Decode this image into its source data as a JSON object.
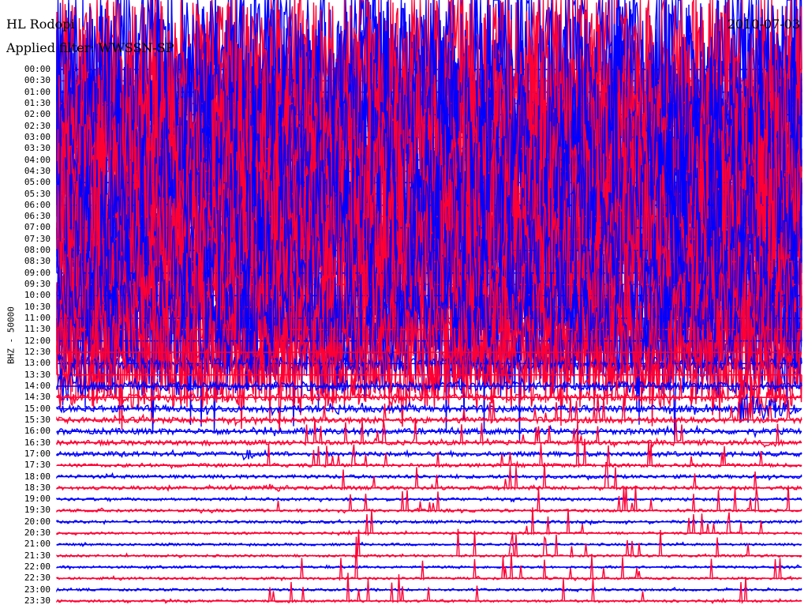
{
  "chart_data": {
    "type": "line",
    "title": "HL Rodopi",
    "subtitle": "Applied filter: WWSSN-SP",
    "date": "2010-07-03",
    "ylabel": "BHZ - 50000",
    "xlabel": "",
    "trace_minutes": 30,
    "series_colors": [
      "#0000ff",
      "#ff0033"
    ],
    "row_labels": [
      "00:00",
      "00:30",
      "01:00",
      "01:30",
      "02:00",
      "02:30",
      "03:00",
      "03:30",
      "04:00",
      "04:30",
      "05:00",
      "05:30",
      "06:00",
      "06:30",
      "07:00",
      "07:30",
      "08:00",
      "08:30",
      "09:00",
      "09:30",
      "10:00",
      "10:30",
      "11:00",
      "11:30",
      "12:00",
      "12:30",
      "13:00",
      "13:30",
      "14:00",
      "14:30",
      "15:00",
      "15:30",
      "16:00",
      "16:30",
      "17:00",
      "17:30",
      "18:00",
      "18:30",
      "19:00",
      "19:30",
      "20:00",
      "20:30",
      "21:00",
      "21:30",
      "22:00",
      "22:30",
      "23:00",
      "23:30"
    ],
    "relative_amplitude": [
      9,
      9,
      9,
      9,
      9,
      9,
      9,
      9,
      9,
      9,
      9,
      9,
      9,
      9,
      9,
      9,
      9,
      9,
      9,
      8,
      7,
      6,
      6,
      5,
      5,
      4,
      0.6,
      3,
      0.4,
      0.3,
      0.3,
      0.25,
      0.25,
      0.2,
      0.2,
      0.15,
      0.15,
      0.15,
      0.12,
      0.12,
      0.12,
      0.1,
      0.1,
      0.1,
      0.1,
      0.1,
      0.1,
      0.1
    ],
    "events": [
      {
        "row": "12:30",
        "start_min": 0,
        "end_min": 3.5,
        "amplitude": 4
      },
      {
        "row": "13:00",
        "start_min": 0,
        "end_min": 3.5,
        "amplitude": 1
      },
      {
        "row": "13:00",
        "start_min": 13,
        "end_min": 14.5,
        "amplitude": 1.5
      },
      {
        "row": "14:00",
        "start_min": 0,
        "end_min": 1.3,
        "amplitude": 2
      },
      {
        "row": "15:00",
        "start_min": 11,
        "end_min": 12.5,
        "amplitude": 0.6
      },
      {
        "row": "15:00",
        "start_min": 27.5,
        "end_min": 30,
        "amplitude": 1.5
      },
      {
        "row": "14:30",
        "start_min": 27.5,
        "end_min": 29,
        "amplitude": 3
      },
      {
        "row": "15:30",
        "start_min": 2.5,
        "end_min": 3.5,
        "amplitude": 0.4
      },
      {
        "row": "17:00",
        "start_min": 7.5,
        "end_min": 8.2,
        "amplitude": 0.6
      },
      {
        "row": "18:30",
        "start_min": 8.5,
        "end_min": 9.5,
        "amplitude": 0.5
      },
      {
        "row": "16:30",
        "start_min": 28.5,
        "end_min": 29,
        "amplitude": 0.4
      }
    ]
  }
}
